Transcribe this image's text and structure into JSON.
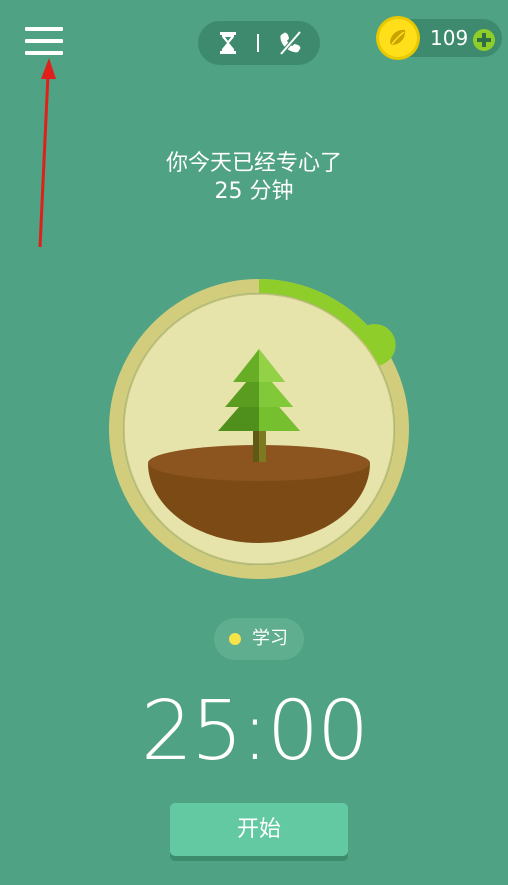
{
  "header": {
    "menu_icon": "hamburger-menu-icon",
    "mode_icons": [
      "hourglass-icon",
      "no-phone-icon"
    ],
    "coin_count": "109",
    "coin_icon": "seed-coin-icon",
    "add_icon": "plus-icon"
  },
  "message": {
    "line1": "你今天已经专心了",
    "line2": "25 分钟"
  },
  "tree": {
    "icon": "pine-tree-icon",
    "progress_fraction": 0.15
  },
  "tag": {
    "label": "学习",
    "color": "#f6e34a"
  },
  "timer": {
    "display": "25:00"
  },
  "start_button": {
    "label": "开始"
  },
  "colors": {
    "background": "#4fa283",
    "ring": "#d2cd7c",
    "progress": "#8fcd2b",
    "inner": "#e6e4ab",
    "soil": "#7b4a15",
    "button": "#63c9a3"
  }
}
